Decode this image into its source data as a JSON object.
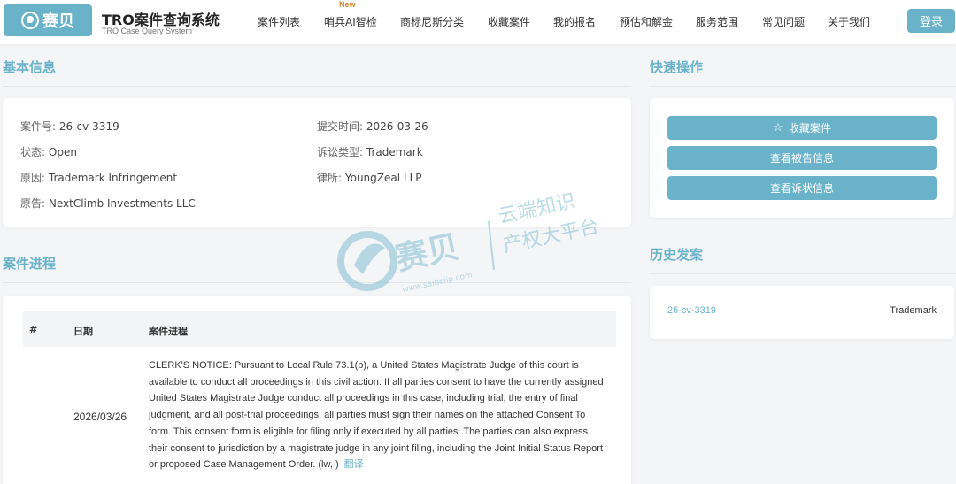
{
  "brand": {
    "logo_text": "赛贝",
    "title": "TRO案件查询系统",
    "subtitle": "TRO Case Query System"
  },
  "nav": {
    "items": [
      {
        "label": "案件列表"
      },
      {
        "label": "哨兵AI智检"
      },
      {
        "label": "商标尼斯分类"
      },
      {
        "label": "收藏案件"
      },
      {
        "label": "我的报名"
      },
      {
        "label": "预估和解金"
      },
      {
        "label": "服务范围"
      },
      {
        "label": "常见问题"
      },
      {
        "label": "关于我们"
      }
    ],
    "new_badge": "New",
    "login": "登录"
  },
  "basic_info": {
    "section_title": "基本信息",
    "case_no_label": "案件号:",
    "case_no": "26-cv-3319",
    "submit_label": "提交时间:",
    "submit_time": "2026-03-26",
    "status_label": "状态:",
    "status": "Open",
    "type_label": "诉讼类型:",
    "type": "Trademark",
    "cause_label": "原因:",
    "cause": "Trademark Infringement",
    "firm_label": "律所:",
    "firm": "YoungZeal LLP",
    "plaintiff_label": "原告:",
    "plaintiff": "NextClimb Investments LLC"
  },
  "quick_actions": {
    "section_title": "快速操作",
    "favorite": "收藏案件",
    "defendant_info": "查看被告信息",
    "complaint_info": "查看诉状信息"
  },
  "progress": {
    "section_title": "案件进程",
    "columns": [
      "#",
      "日期",
      "案件进程"
    ],
    "rows": [
      {
        "date": "2026/03/26",
        "text": "CLERK'S NOTICE: Pursuant to Local Rule 73.1(b), a United States Magistrate Judge of this court is available to conduct all proceedings in this civil action. If all parties consent to have the currently assigned United States Magistrate Judge conduct all proceedings in this case, including trial, the entry of final judgment, and all post-trial proceedings, all parties must sign their names on the attached Consent To form. This consent form is eligible for filing only if executed by all parties. The parties can also express their consent to jurisdiction by a magistrate judge in any joint filing, including the Joint Initial Status Report or proposed Case Management Order. (lw, )",
        "translate": "翻译"
      }
    ]
  },
  "history": {
    "section_title": "历史发案",
    "items": [
      {
        "case": "26-cv-3319",
        "type": "Trademark"
      }
    ]
  },
  "watermark": {
    "brand": "赛贝",
    "url": "www.saibeiip.com",
    "line1": "云端知识",
    "line2": "产权大平台"
  }
}
